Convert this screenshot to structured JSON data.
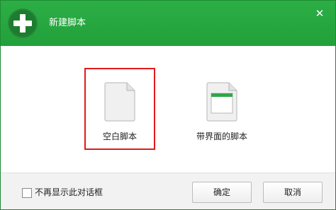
{
  "window": {
    "title": "新建脚本",
    "app_icon": "plus-icon",
    "close_symbol": "✕",
    "accent_color": "#26a641"
  },
  "options": [
    {
      "label": "空白脚本",
      "icon": "blank-document-icon",
      "selected": true
    },
    {
      "label": "带界面的脚本",
      "icon": "ui-document-icon",
      "selected": false
    }
  ],
  "footer": {
    "checkbox_label": "不再显示此对话框",
    "checkbox_checked": false,
    "ok_label": "确定",
    "cancel_label": "取消"
  },
  "selection_color": "#e01b1b"
}
